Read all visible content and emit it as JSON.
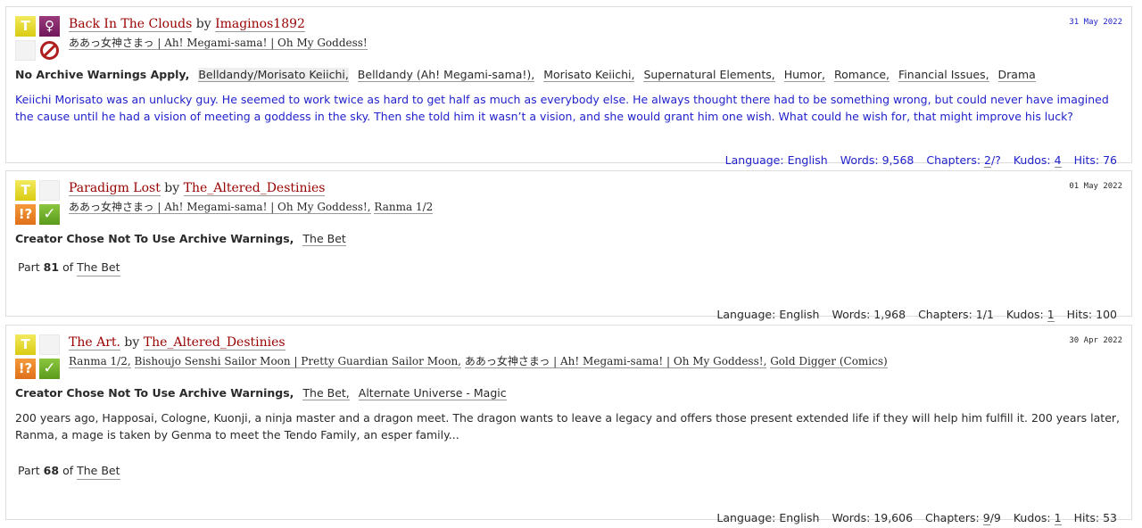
{
  "works": [
    {
      "title": "Back In The Clouds",
      "by": "by",
      "author": "Imaginos1892",
      "date": "31 May 2022",
      "fandoms": [
        "ああっ女神さまっ | Ah! Megami-sama! | Oh My Goddess!"
      ],
      "icons": {
        "rating": "T",
        "category": "♀",
        "warnings": "no-warnings-applied-icon",
        "complete": ""
      },
      "warning": "No Archive Warnings Apply,",
      "tags": [
        "Belldandy/Morisato Keiichi,",
        "Belldandy (Ah! Megami-sama!),",
        "Morisato Keiichi,",
        "Supernatural Elements,",
        "Humor,",
        "Romance,",
        "Financial Issues,",
        "Drama"
      ],
      "summary": "Keiichi Morisato was an unlucky guy. He seemed to work twice as hard to get half as much as everybody else. He always thought there had to be something wrong, but could never have imagined the cause until he had a vision of meeting a goddess in the sky. Then she told him it wasn’t a vision, and she would grant him one wish. What could he wish for, that might improve his luck?",
      "stats": {
        "language_label": "Language:",
        "language": "English",
        "words_label": "Words:",
        "words": "9,568",
        "chapters_label": "Chapters:",
        "chapters_posted": "2",
        "chapters_total": "/?",
        "kudos_label": "Kudos:",
        "kudos": "4",
        "hits_label": "Hits:",
        "hits": "76"
      }
    },
    {
      "title": "Paradigm Lost",
      "by": "by",
      "author": "The_Altered_Destinies",
      "date": "01 May 2022",
      "fandoms": [
        "ああっ女神さまっ | Ah! Megami-sama! | Oh My Goddess!,",
        "Ranma 1/2"
      ],
      "icons": {
        "rating": "T",
        "category": "",
        "warnings": "!?",
        "complete": "✓"
      },
      "warning": "Creator Chose Not To Use Archive Warnings,",
      "tags": [
        "The Bet"
      ],
      "series": {
        "part_label": "Part",
        "part": "81",
        "of": "of",
        "name": "The Bet"
      },
      "stats": {
        "language_label": "Language:",
        "language": "English",
        "words_label": "Words:",
        "words": "1,968",
        "chapters_label": "Chapters:",
        "chapters_posted": "1",
        "chapters_total": "/1",
        "kudos_label": "Kudos:",
        "kudos": "1",
        "hits_label": "Hits:",
        "hits": "100"
      }
    },
    {
      "title": "The Art.",
      "by": "by",
      "author": "The_Altered_Destinies",
      "date": "30 Apr 2022",
      "fandoms": [
        "Ranma 1/2,",
        "Bishoujo Senshi Sailor Moon | Pretty Guardian Sailor Moon,",
        "ああっ女神さまっ | Ah! Megami-sama! | Oh My Goddess!,",
        "Gold Digger (Comics)"
      ],
      "icons": {
        "rating": "T",
        "category": "",
        "warnings": "!?",
        "complete": "✓"
      },
      "warning": "Creator Chose Not To Use Archive Warnings,",
      "tags": [
        "The Bet,",
        "Alternate Universe - Magic"
      ],
      "summary": "200 years ago, Happosai, Cologne, Kuonji, a ninja master and a dragon meet. The dragon wants to leave a legacy and offers those present extended life if they will help him fulfill it. 200 years later, Ranma, a mage is taken by Genma to meet the Tendo Family, an esper family...",
      "series": {
        "part_label": "Part",
        "part": "68",
        "of": "of",
        "name": "The Bet"
      },
      "stats": {
        "language_label": "Language:",
        "language": "English",
        "words_label": "Words:",
        "words": "19,606",
        "chapters_label": "Chapters:",
        "chapters_posted": "9",
        "chapters_total": "/9",
        "kudos_label": "Kudos:",
        "kudos": "1",
        "hits_label": "Hits:",
        "hits": "53"
      }
    }
  ],
  "colors": {
    "title_link": "#990000",
    "highlight_blue": "#2222cc",
    "rating_teen": "#e5d82a",
    "category_ff": "#8a2a6e",
    "warning_orange": "#e8801f",
    "complete_green": "#6fac2c",
    "no_warning_red": "#b01e1e"
  }
}
